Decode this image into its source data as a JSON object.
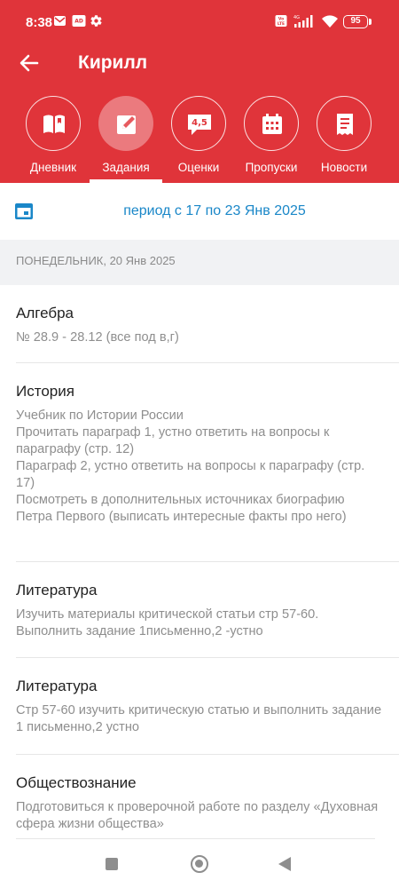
{
  "status_bar": {
    "time": "8:38",
    "battery": "95",
    "icons": [
      "mail-icon",
      "ad-icon",
      "gear-icon",
      "volte-icon",
      "signal-icon",
      "wifi-icon",
      "battery-icon"
    ]
  },
  "header": {
    "title": "Кирилл",
    "back_icon": "arrow-left-icon"
  },
  "tabs": [
    {
      "label": "Дневник",
      "icon": "book-icon",
      "active": false
    },
    {
      "label": "Задания",
      "icon": "edit-icon",
      "active": true
    },
    {
      "label": "Оценки",
      "icon": "grades-icon",
      "badge": "4,5",
      "active": false
    },
    {
      "label": "Пропуски",
      "icon": "calendar-grid-icon",
      "active": false
    },
    {
      "label": "Новости",
      "icon": "news-icon",
      "active": false
    }
  ],
  "period": {
    "text": "период с 17 по 23 Янв 2025",
    "icon": "calendar-icon"
  },
  "day": {
    "label": "ПОНЕДЕЛЬНИК, 20 Янв 2025"
  },
  "tasks": [
    {
      "subject": "Алгебра",
      "description": "№ 28.9 - 28.12 (все под в,г)"
    },
    {
      "subject": "История",
      "description": "Учебник по Истории России\nПрочитать параграф 1, устно ответить на вопросы к параграфу (стр. 12)\nПараграф 2, устно ответить на вопросы к параграфу (стр. 17)\nПосмотреть в дополнительных источниках биографию Петра Первого (выписать интересные факты про него)"
    },
    {
      "subject": "Литература",
      "description": "Изучить материалы критической статьи стр 57-60.\nВыполнить задание 1письменно,2 -устно"
    },
    {
      "subject": "Литература",
      "description": "Стр 57-60 изучить критическую статью и выполнить задание 1 письменно,2 устно"
    },
    {
      "subject": "Обществознание",
      "description": "Подготовиться к проверочной работе по разделу «Духовная сфера жизни общества»"
    }
  ],
  "colors": {
    "header": "#e0343a",
    "accent": "#1a87c8",
    "muted_text": "#8e8e8e"
  }
}
